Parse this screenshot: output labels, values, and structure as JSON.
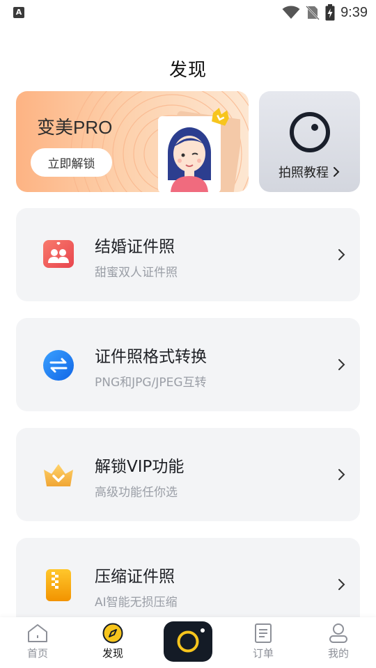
{
  "status_bar": {
    "time": "9:39",
    "left_icon": "A",
    "icons": [
      "wifi-icon",
      "no-sim-icon",
      "battery-charging-icon"
    ]
  },
  "page": {
    "title": "发现"
  },
  "banners": {
    "pro": {
      "title": "变美PRO",
      "button_label": "立即解锁"
    },
    "tutorial": {
      "label": "拍照教程"
    }
  },
  "features": [
    {
      "title": "结婚证件照",
      "subtitle": "甜蜜双人证件照",
      "icon": "couple-icon",
      "color": "#ef5a55"
    },
    {
      "title": "证件照格式转换",
      "subtitle": "PNG和JPG/JPEG互转",
      "icon": "swap-icon",
      "color": "#1e7ff0"
    },
    {
      "title": "解锁VIP功能",
      "subtitle": "高级功能任你选",
      "icon": "crown-icon",
      "color": "#f3b042"
    },
    {
      "title": "压缩证件照",
      "subtitle": "AI智能无损压缩",
      "icon": "zip-icon",
      "color": "#f5a300"
    }
  ],
  "bottom_nav": {
    "items": [
      {
        "label": "首页",
        "icon": "home-icon",
        "active": false
      },
      {
        "label": "发现",
        "icon": "compass-icon",
        "active": true
      },
      {
        "label": "",
        "icon": "camera-icon",
        "active": false
      },
      {
        "label": "订单",
        "icon": "order-icon",
        "active": false
      },
      {
        "label": "我的",
        "icon": "profile-icon",
        "active": false
      }
    ]
  },
  "colors": {
    "accent_yellow": "#f7c51d",
    "dark": "#141b26",
    "card_bg": "#f3f4f6"
  }
}
